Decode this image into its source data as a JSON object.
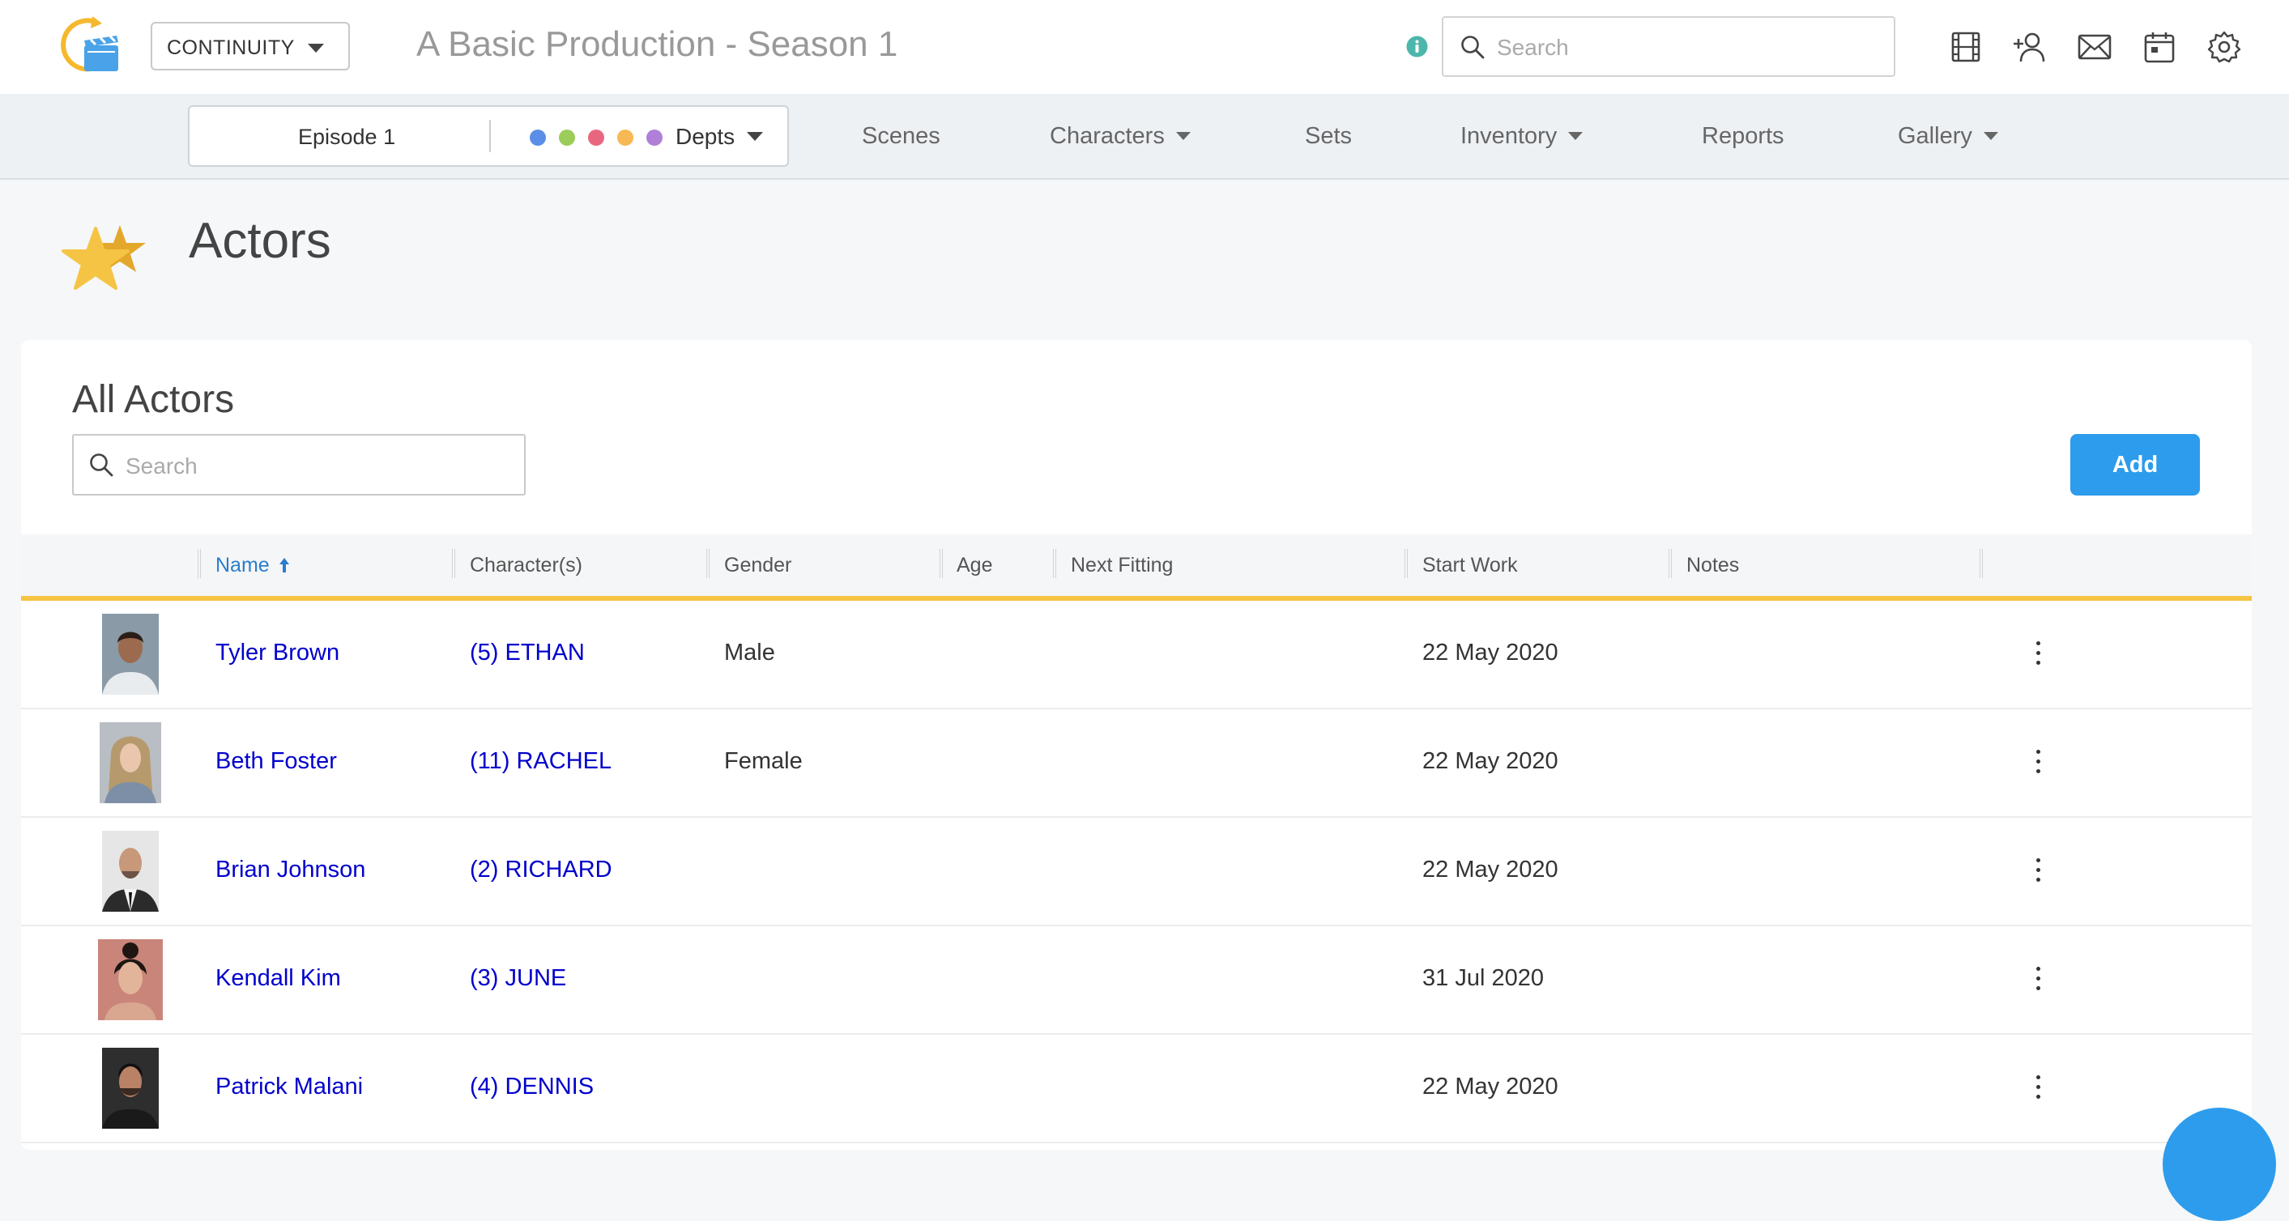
{
  "header": {
    "module_select": "CONTINUITY",
    "production_title": "A Basic Production - Season 1",
    "search_placeholder": "Search",
    "icons": [
      "info-icon",
      "film-icon",
      "add-user-icon",
      "mail-icon",
      "calendar-icon",
      "settings-icon"
    ]
  },
  "nav": {
    "episode": "Episode 1",
    "dept_colors": [
      "#5b8ee6",
      "#9ccc5a",
      "#e8677e",
      "#f7b955",
      "#b07fd8"
    ],
    "depts_label": "Depts",
    "items": [
      {
        "label": "Scenes",
        "has_dropdown": false
      },
      {
        "label": "Characters",
        "has_dropdown": true
      },
      {
        "label": "Sets",
        "has_dropdown": false
      },
      {
        "label": "Inventory",
        "has_dropdown": true
      },
      {
        "label": "Reports",
        "has_dropdown": false
      },
      {
        "label": "Gallery",
        "has_dropdown": true
      }
    ]
  },
  "page": {
    "title": "Actors",
    "icon": "star-icon"
  },
  "card": {
    "title": "All Actors",
    "search_placeholder": "Search",
    "add_label": "Add"
  },
  "table": {
    "columns": [
      "Name",
      "Character(s)",
      "Gender",
      "Age",
      "Next Fitting",
      "Start Work",
      "Notes"
    ],
    "sort_column": "Name",
    "sort_direction": "ascending",
    "rows": [
      {
        "name": "Tyler Brown",
        "characters": "(5) ETHAN",
        "gender": "Male",
        "age": "",
        "next_fitting": "",
        "start_work": "22 May 2020",
        "notes": ""
      },
      {
        "name": "Beth Foster",
        "characters": "(11) RACHEL",
        "gender": "Female",
        "age": "",
        "next_fitting": "",
        "start_work": "22 May 2020",
        "notes": ""
      },
      {
        "name": "Brian Johnson",
        "characters": "(2) RICHARD",
        "gender": "",
        "age": "",
        "next_fitting": "",
        "start_work": "22 May 2020",
        "notes": ""
      },
      {
        "name": "Kendall Kim",
        "characters": "(3) JUNE",
        "gender": "",
        "age": "",
        "next_fitting": "",
        "start_work": "31 Jul 2020",
        "notes": ""
      },
      {
        "name": "Patrick Malani",
        "characters": "(4) DENNIS",
        "gender": "",
        "age": "",
        "next_fitting": "",
        "start_work": "22 May 2020",
        "notes": ""
      }
    ]
  },
  "colors": {
    "accent": "#2d9cec",
    "link": "#0000cc",
    "header_underline": "#f5c443",
    "info": "#4db6ac"
  }
}
